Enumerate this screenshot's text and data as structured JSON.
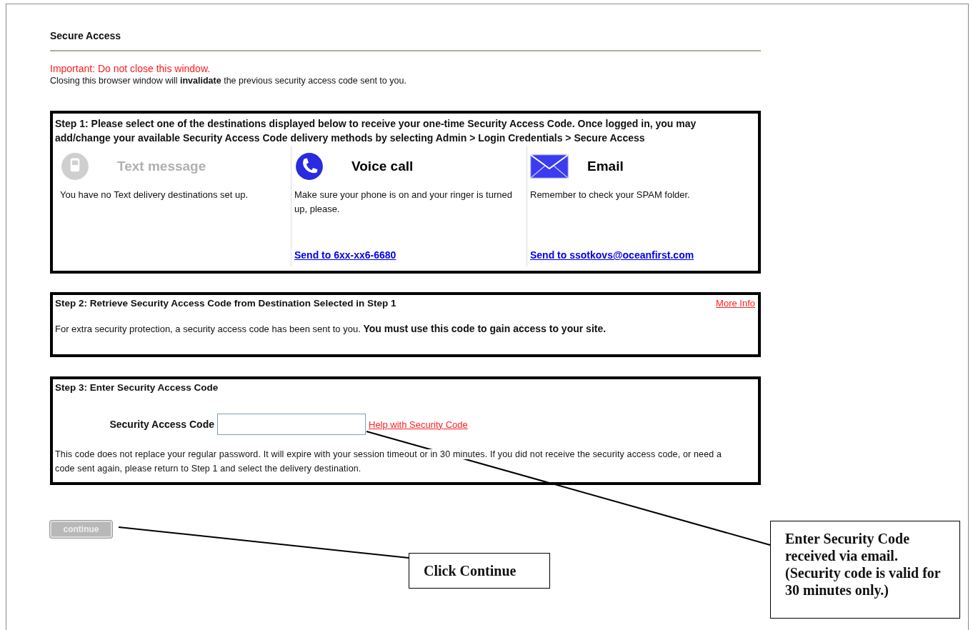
{
  "header": {
    "title": "Secure Access"
  },
  "warning": {
    "title": "Important: Do not close this window.",
    "text": "Closing this browser window will **invalidate** the previous security access code sent to you."
  },
  "step1": {
    "text": "Step 1: Please select one of the destinations displayed below to receive your one-time Security Access Code. Once logged in, you may add/change your available Security Access Code delivery methods by selecting Admin > Login Credentials > Secure Access",
    "options": [
      {
        "kind": "text",
        "title": "Text message",
        "disabled": true,
        "note": "You have no Text delivery destinations set up."
      },
      {
        "kind": "voice",
        "title": "Voice call",
        "disabled": false,
        "note": "Make sure your phone is on and your ringer is turned up, please.",
        "link": "Send to 6xx-xx6-6680"
      },
      {
        "kind": "email",
        "title": "Email",
        "disabled": false,
        "note": "Remember to check your SPAM folder.",
        "link": "Send to ssotkovs@oceanfirst.com"
      }
    ]
  },
  "step2": {
    "title": "Step 2: Retrieve Security Access Code from Destination Selected in Step 1",
    "link": "More Info",
    "text": "For extra security protection, a security access code has been sent to you. **You must use this code to gain access to your site.**"
  },
  "step3": {
    "title": "Step 3: Enter Security Access Code",
    "field_label": "Security Access Code",
    "help_link": "Help with Security Code",
    "text": "This code does not replace your regular password. It will expire with your session timeout or in 30 minutes. If you did not receive the security access code, or need a code sent again, please return to Step 1 and select the delivery destination."
  },
  "continue_button": {
    "label": "continue",
    "disabled": true
  },
  "callouts": [
    {
      "text": "Click Continue"
    },
    {
      "text": "Enter Security Code received via email. (Security code is valid for 30 minutes only.)"
    }
  ]
}
